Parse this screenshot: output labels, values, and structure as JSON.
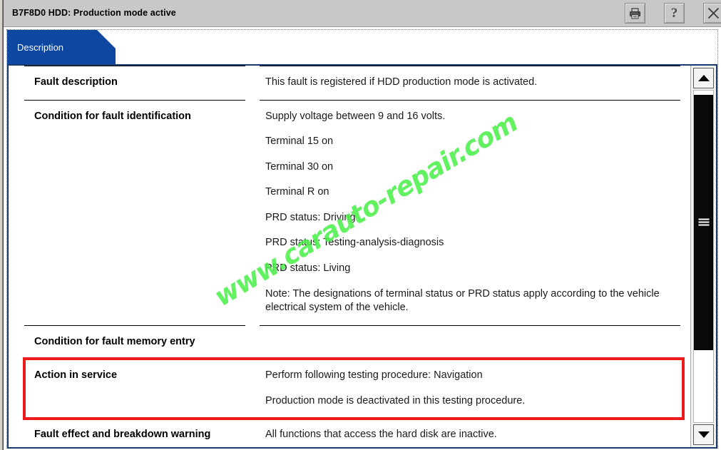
{
  "window": {
    "title": "B7F8D0 HDD: Production mode active"
  },
  "titlebar_buttons": [
    {
      "name": "print-button",
      "label": "Print"
    },
    {
      "name": "help-button",
      "label": "?"
    },
    {
      "name": "close-button",
      "label": "Close"
    }
  ],
  "help_button_glyph": "?",
  "tabs": [
    {
      "label": "Description",
      "active": true
    }
  ],
  "content": {
    "rows": [
      {
        "label": "Fault description",
        "paragraphs": [
          "This fault is registered if HDD production mode is activated."
        ]
      },
      {
        "label": "Condition for fault identification",
        "paragraphs": [
          "Supply voltage between 9 and 16 volts.",
          "Terminal 15 on",
          "Terminal 30 on",
          "Terminal R on",
          "PRD status: Driving",
          "PRD status: Testing-analysis-diagnosis",
          "PRD status: Living",
          "Note: The designations of terminal status or PRD status apply according to the vehicle electrical system of the vehicle."
        ]
      },
      {
        "label": "Condition for fault memory entry",
        "paragraphs": []
      },
      {
        "label": "Action in service",
        "paragraphs": [
          "Perform following testing procedure: Navigation",
          "Production mode is deactivated in this testing procedure."
        ],
        "highlighted": true
      },
      {
        "label": "Fault effect and breakdown warning",
        "paragraphs": [
          "All functions that access the hard disk are inactive."
        ]
      }
    ]
  },
  "watermark": {
    "text": "www.carauto-repair.com",
    "color": "#4cf04c"
  },
  "scrollbar": {
    "up_arrow": "scroll-up",
    "down_arrow": "scroll-down"
  },
  "colors": {
    "tab_active": "#0d47a1",
    "panel_border": "#1a3b6e",
    "highlight": "#ee1b1b",
    "titlebar": "#c8c8c8"
  }
}
